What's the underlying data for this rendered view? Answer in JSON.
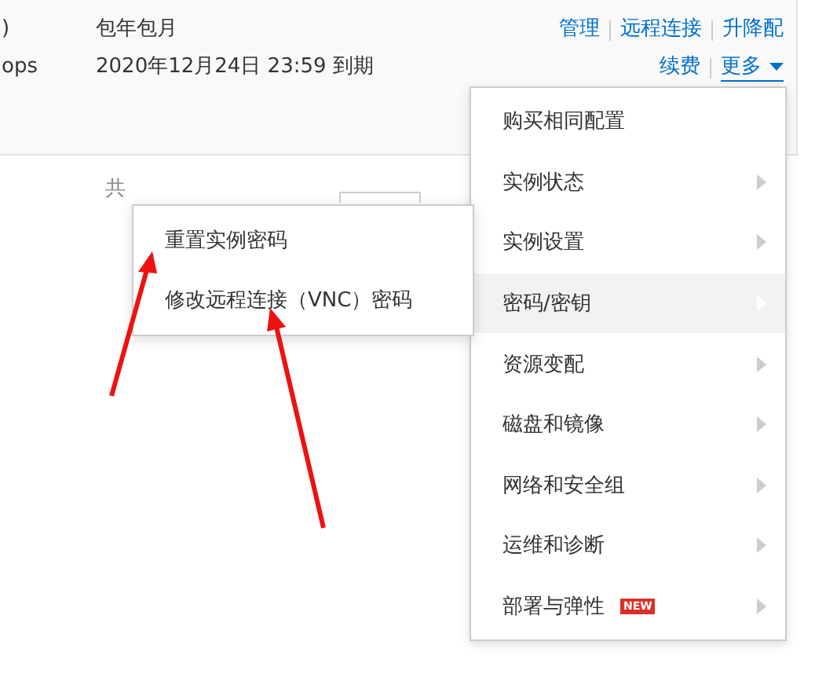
{
  "instance_row": {
    "name_fragment": ")",
    "spec_fragment": "ops",
    "billing": "包年包月",
    "expiry": "2020年12月24日 23:59 到期",
    "actions_top": [
      "管理",
      "远程连接",
      "升降配"
    ],
    "actions_bottom": [
      "续费"
    ],
    "more": "更多"
  },
  "pagination": {
    "total": "共"
  },
  "menu": [
    {
      "label": "购买相同配置",
      "has_submenu": false,
      "selected": false
    },
    {
      "label": "实例状态",
      "has_submenu": true,
      "selected": false
    },
    {
      "label": "实例设置",
      "has_submenu": true,
      "selected": false
    },
    {
      "label": "密码/密钥",
      "has_submenu": true,
      "selected": true
    },
    {
      "label": "资源变配",
      "has_submenu": true,
      "selected": false
    },
    {
      "label": "磁盘和镜像",
      "has_submenu": true,
      "selected": false
    },
    {
      "label": "网络和安全组",
      "has_submenu": true,
      "selected": false
    },
    {
      "label": "运维和诊断",
      "has_submenu": true,
      "selected": false
    },
    {
      "label": "部署与弹性",
      "has_submenu": true,
      "selected": false,
      "badge": "NEW"
    }
  ],
  "submenu": [
    {
      "label": "重置实例密码"
    },
    {
      "label": "修改远程连接（VNC）密码"
    }
  ]
}
